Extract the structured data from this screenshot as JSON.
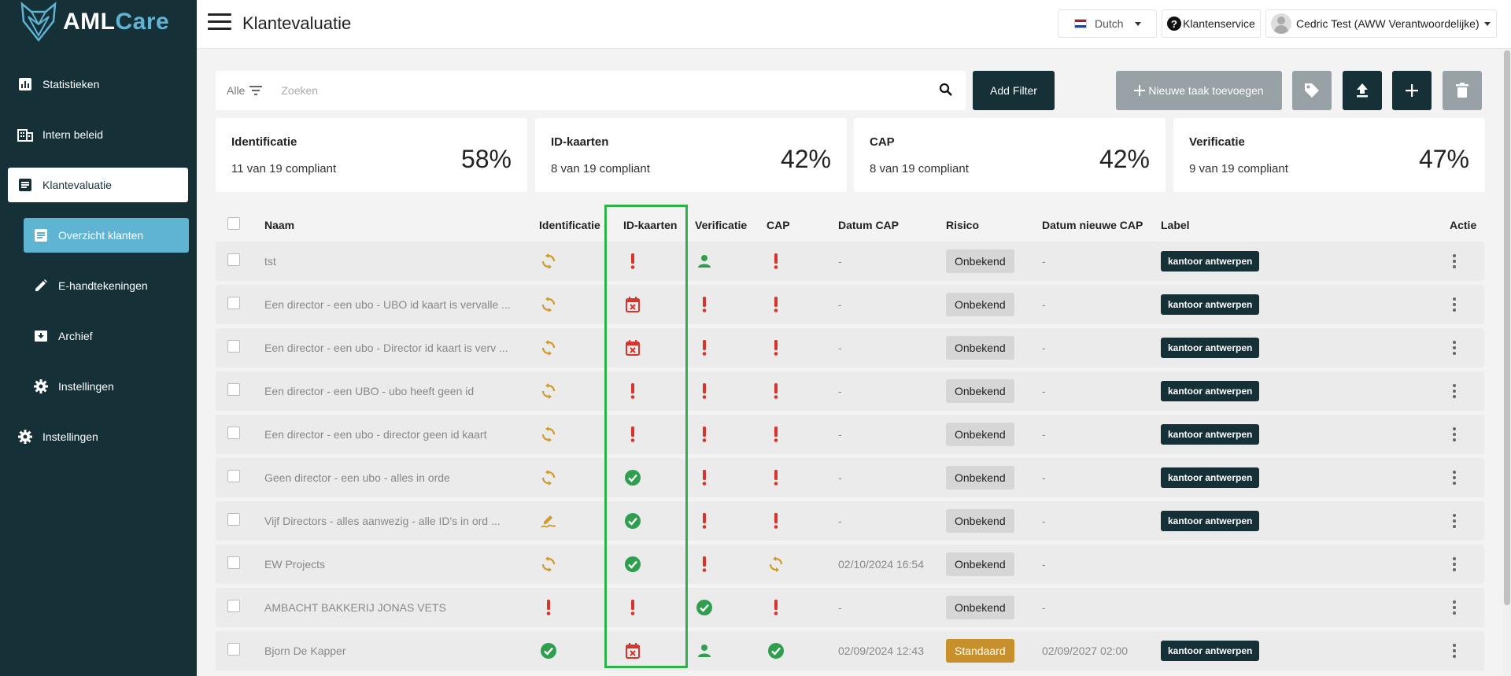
{
  "app": {
    "name_part1": "AML",
    "name_part2": "Care"
  },
  "sidebar": {
    "items": [
      {
        "label": "Statistieken",
        "icon": "bar-chart-icon"
      },
      {
        "label": "Intern beleid",
        "icon": "building-icon"
      },
      {
        "label": "Klantevaluatie",
        "icon": "document-icon"
      },
      {
        "label": "Overzicht klanten",
        "icon": "list-icon"
      },
      {
        "label": "E-handtekeningen",
        "icon": "pen-icon"
      },
      {
        "label": "Archief",
        "icon": "archive-icon"
      },
      {
        "label": "Instellingen",
        "icon": "gear-icon"
      },
      {
        "label": "Instellingen",
        "icon": "gear-icon"
      }
    ]
  },
  "header": {
    "title": "Klantevaluatie",
    "language": "Dutch",
    "support": "Klantenservice",
    "user": "Cedric Test (AWW Verantwoordelijke)"
  },
  "search": {
    "filter_label": "Alle",
    "placeholder": "Zoeken",
    "value": ""
  },
  "toolbar": {
    "add_filter": "Add Filter",
    "new_task": "Nieuwe taak toevoegen"
  },
  "cards": [
    {
      "title": "Identificatie",
      "sub": "11 van 19 compliant",
      "pct": "58%"
    },
    {
      "title": "ID-kaarten",
      "sub": "8 van 19 compliant",
      "pct": "42%"
    },
    {
      "title": "CAP",
      "sub": "8 van 19 compliant",
      "pct": "42%"
    },
    {
      "title": "Verificatie",
      "sub": "9 van 19 compliant",
      "pct": "47%"
    }
  ],
  "table": {
    "headers": {
      "naam": "Naam",
      "identificatie": "Identificatie",
      "idkaarten": "ID-kaarten",
      "verificatie": "Verificatie",
      "cap": "CAP",
      "datumcap": "Datum CAP",
      "risico": "Risico",
      "datumnieuwecap": "Datum nieuwe CAP",
      "label": "Label",
      "actie": "Actie"
    },
    "rows": [
      {
        "naam": "tst",
        "ident": "sync",
        "idk": "alert",
        "verif": "person",
        "cap": "alert",
        "datumcap": "-",
        "risico": "Onbekend",
        "risk_type": "unknown",
        "datumnieuwecap": "-",
        "label": "kantoor antwerpen"
      },
      {
        "naam": "Een director - een ubo - UBO id kaart is vervalle ...",
        "ident": "sync",
        "idk": "cal",
        "verif": "alert",
        "cap": "alert",
        "datumcap": "-",
        "risico": "Onbekend",
        "risk_type": "unknown",
        "datumnieuwecap": "-",
        "label": "kantoor antwerpen"
      },
      {
        "naam": "Een director - een ubo - Director id kaart is verv ...",
        "ident": "sync",
        "idk": "cal",
        "verif": "alert",
        "cap": "alert",
        "datumcap": "-",
        "risico": "Onbekend",
        "risk_type": "unknown",
        "datumnieuwecap": "-",
        "label": "kantoor antwerpen"
      },
      {
        "naam": "Een director - een UBO - ubo heeft geen id",
        "ident": "sync",
        "idk": "alert",
        "verif": "alert",
        "cap": "alert",
        "datumcap": "-",
        "risico": "Onbekend",
        "risk_type": "unknown",
        "datumnieuwecap": "-",
        "label": "kantoor antwerpen"
      },
      {
        "naam": "Een director - een ubo - director geen id kaart",
        "ident": "sync",
        "idk": "alert",
        "verif": "alert",
        "cap": "alert",
        "datumcap": "-",
        "risico": "Onbekend",
        "risk_type": "unknown",
        "datumnieuwecap": "-",
        "label": "kantoor antwerpen"
      },
      {
        "naam": "Geen director - een ubo - alles in orde",
        "ident": "sync",
        "idk": "check",
        "verif": "alert",
        "cap": "alert",
        "datumcap": "-",
        "risico": "Onbekend",
        "risk_type": "unknown",
        "datumnieuwecap": "-",
        "label": "kantoor antwerpen"
      },
      {
        "naam": "Vijf Directors - alles aanwezig - alle ID's in ord ...",
        "ident": "sign",
        "idk": "check",
        "verif": "alert",
        "cap": "alert",
        "datumcap": "-",
        "risico": "Onbekend",
        "risk_type": "unknown",
        "datumnieuwecap": "-",
        "label": "kantoor antwerpen"
      },
      {
        "naam": "EW Projects",
        "ident": "sync",
        "idk": "check",
        "verif": "alert",
        "cap": "sync",
        "datumcap": "02/10/2024 16:54",
        "risico": "Onbekend",
        "risk_type": "unknown",
        "datumnieuwecap": "-",
        "label": ""
      },
      {
        "naam": "AMBACHT BAKKERIJ JONAS VETS",
        "ident": "alert",
        "idk": "alert",
        "verif": "check",
        "cap": "alert",
        "datumcap": "-",
        "risico": "Onbekend",
        "risk_type": "unknown",
        "datumnieuwecap": "-",
        "label": ""
      },
      {
        "naam": "Bjorn De Kapper",
        "ident": "check",
        "idk": "cal",
        "verif": "person",
        "cap": "check",
        "datumcap": "02/09/2024 12:43",
        "risico": "Standaard",
        "risk_type": "standard",
        "datumnieuwecap": "02/09/2027 02:00",
        "label": "kantoor antwerpen"
      }
    ]
  },
  "colors": {
    "sidebar": "#163038",
    "accent": "#5fb4d4",
    "alert": "#d9342b",
    "sync": "#d19a2a",
    "check": "#2f9e4f",
    "highlight": "#2db24a",
    "standard": "#c8902a"
  }
}
